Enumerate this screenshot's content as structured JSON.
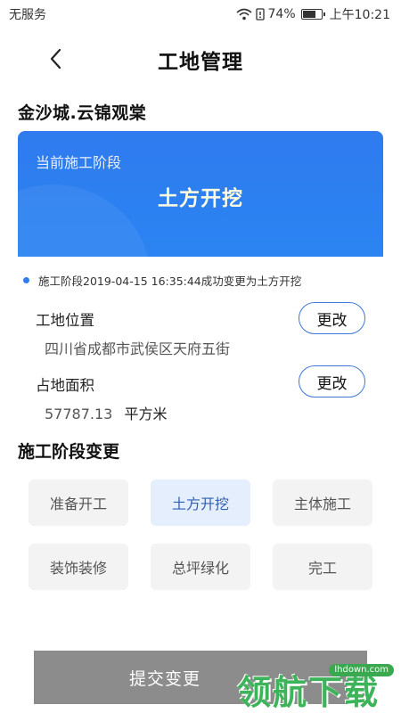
{
  "status_bar": {
    "carrier": "无服务",
    "battery_percent": "74%",
    "battery_level": 0.74,
    "time": "上午10:21"
  },
  "header": {
    "back_icon": "chevron-left-icon",
    "title": "工地管理"
  },
  "site": {
    "name": "金沙城.云锦观棠"
  },
  "current_stage": {
    "label": "当前施工阶段",
    "value": "土方开挖"
  },
  "log": {
    "text": "施工阶段2019-04-15 16:35:44成功变更为土方开挖"
  },
  "location": {
    "label": "工地位置",
    "value": "四川省成都市武侯区天府五街",
    "change_label": "更改"
  },
  "area": {
    "label": "占地面积",
    "value": "57787.13",
    "unit": "平方米",
    "change_label": "更改"
  },
  "stage_change": {
    "title": "施工阶段变更",
    "options": [
      "准备开工",
      "土方开挖",
      "主体施工",
      "装饰装修",
      "总坪绿化",
      "完工"
    ],
    "selected": "土方开挖"
  },
  "submit": {
    "label": "提交变更"
  },
  "watermark": {
    "logo_text": "领航下载",
    "domain": "lhdown.com"
  },
  "colors": {
    "accent": "#2f7bef",
    "submit_bg": "#8c8c8c",
    "selected_bg": "#e4eefc"
  }
}
